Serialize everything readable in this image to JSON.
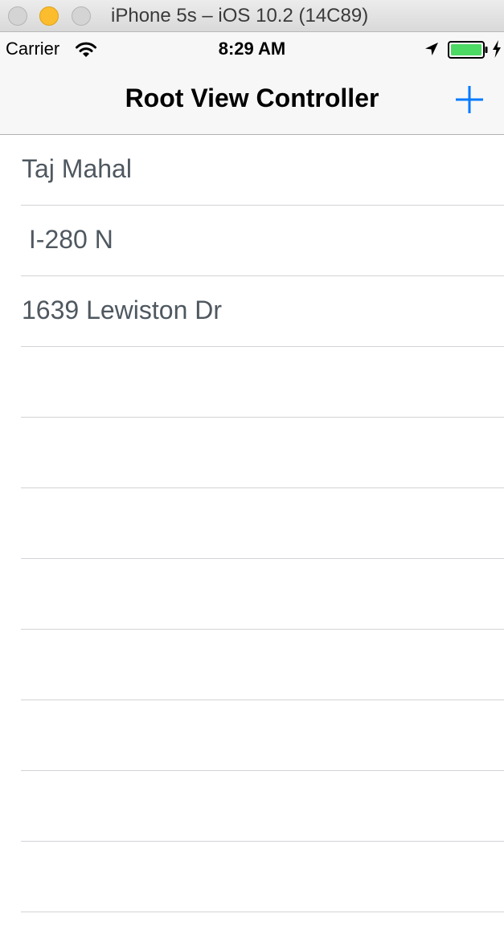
{
  "window": {
    "title": "iPhone 5s – iOS 10.2 (14C89)"
  },
  "status_bar": {
    "carrier": "Carrier",
    "time": "8:29 AM",
    "icons": [
      "wifi-icon",
      "location-arrow-icon",
      "battery-icon",
      "charging-bolt-icon"
    ],
    "battery_color": "#4cd964"
  },
  "nav_bar": {
    "title": "Root View Controller",
    "add_button_icon": "plus-icon",
    "tint_color": "#007aff"
  },
  "table": {
    "rows": [
      {
        "label": "Taj Mahal"
      },
      {
        "label": " I-280 N"
      },
      {
        "label": "1639 Lewiston Dr"
      },
      {
        "label": ""
      },
      {
        "label": ""
      },
      {
        "label": ""
      },
      {
        "label": ""
      },
      {
        "label": ""
      },
      {
        "label": ""
      },
      {
        "label": ""
      },
      {
        "label": ""
      }
    ]
  }
}
